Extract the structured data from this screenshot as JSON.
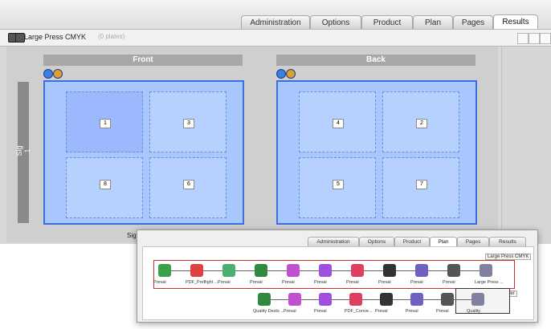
{
  "tabs": [
    {
      "label": "Administration",
      "active": false
    },
    {
      "label": "Options",
      "active": false
    },
    {
      "label": "Product",
      "active": false
    },
    {
      "label": "Plan",
      "active": false
    },
    {
      "label": "Pages",
      "active": false
    },
    {
      "label": "Results",
      "active": true
    }
  ],
  "toolbar": {
    "press_label": "Large Press CMYK",
    "plates": "(0 plates)"
  },
  "layout": {
    "front_header": "Front",
    "back_header": "Back",
    "signature_label": "Sig 1",
    "caption": "Sig 1 F",
    "front_pages": [
      "1",
      "3",
      "8",
      "6"
    ],
    "back_pages": [
      "4",
      "2",
      "5",
      "7"
    ]
  },
  "popup": {
    "tabs": [
      {
        "label": "Administration",
        "active": false
      },
      {
        "label": "Options",
        "active": false
      },
      {
        "label": "Product",
        "active": false
      },
      {
        "label": "Plan",
        "active": true
      },
      {
        "label": "Pages",
        "active": false
      },
      {
        "label": "Results",
        "active": false
      }
    ],
    "row1_labels": [
      "Preval",
      "PDF_Preflight ...",
      "Preval",
      "Preval",
      "Preval",
      "Preval",
      "Preval",
      "Preval",
      "Preval",
      "Preval",
      "Large Press ..."
    ],
    "row1_profile": "Large Press CMYK",
    "row2_labels": [
      "Quality Dests ...",
      "Preval",
      "Preval",
      "PDF_Conve...",
      "Preval",
      "Preval",
      "Preval",
      "Quality"
    ],
    "row2_profile": "Ink jet proofer"
  },
  "colors": {
    "sheet_fill": "#a9c7ff",
    "sheet_border": "#3a6fe0",
    "flow_box": "#d03030"
  }
}
